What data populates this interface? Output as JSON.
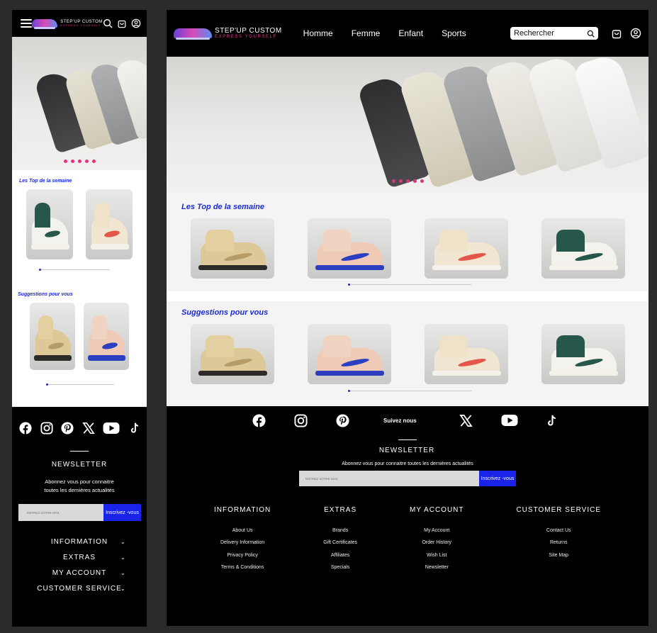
{
  "brand": {
    "title": "STEP'UP CUSTOM",
    "subtitle": "EXPRESS YOURSELF"
  },
  "nav": {
    "items": [
      "Homme",
      "Femme",
      "Enfant",
      "Sports"
    ]
  },
  "search": {
    "placeholder": "Rechercher"
  },
  "sections": {
    "top": "Les Top de la semaine",
    "suggestions": "Suggestions pour vous"
  },
  "social": {
    "follow": "Suivez nous",
    "icons": [
      "facebook-icon",
      "instagram-icon",
      "pinterest-icon",
      "x-icon",
      "youtube-icon",
      "tiktok-icon"
    ]
  },
  "newsletter": {
    "title": "NEWSLETTER",
    "text": "Abonnez vous pour connaitre toutes les dernières actualités",
    "text_line1": "Abonnez vous pour connaitre",
    "text_line2": "toutes les dernières actualités",
    "placeholder": "ENTREZ VOTRE MAIL",
    "button": "Inscrivez -vous"
  },
  "footer": {
    "columns": [
      {
        "title": "INFORMATION",
        "links": [
          "About Us",
          "Delivery Information",
          "Privacy Policy",
          "Terms & Conditions"
        ]
      },
      {
        "title": "EXTRAS",
        "links": [
          "Brands",
          "Gift Certificates",
          "Affiliates",
          "Specials"
        ]
      },
      {
        "title": "MY ACCOUNT",
        "links": [
          "My Account",
          "Order History",
          "Wish List",
          "Newsletter"
        ]
      },
      {
        "title": "CUSTOMER SERVICE",
        "links": [
          "Contact Us",
          "Returns",
          "Site Map"
        ]
      }
    ]
  },
  "colors": {
    "accent": "#1a24e8",
    "title_blue": "#1a2bd4",
    "dot_pink": "#e0337f",
    "background": "#000000"
  }
}
